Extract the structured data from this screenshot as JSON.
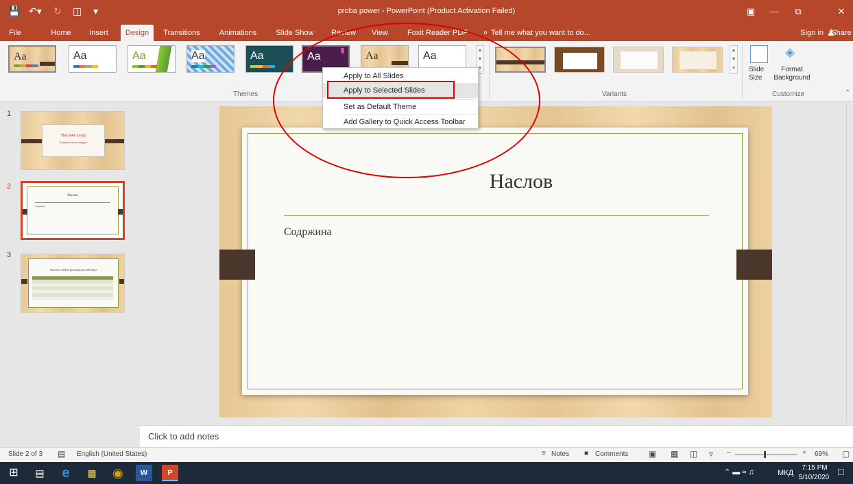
{
  "window": {
    "title": "proba power - PowerPoint (Product Activation Failed)",
    "quick_access": [
      "save-icon",
      "undo-icon",
      "redo-icon",
      "start-from-beginning-icon",
      "customize-icon"
    ]
  },
  "tabs": [
    "File",
    "Home",
    "Insert",
    "Design",
    "Transitions",
    "Animations",
    "Slide Show",
    "Review",
    "View",
    "Foxit Reader PDF"
  ],
  "tell_me": "Tell me what you want to do...",
  "account": {
    "sign_in": "Sign in",
    "share": "Share"
  },
  "ribbon": {
    "themes_label": "Themes",
    "variants_label": "Variants",
    "customize_label": "Customize",
    "theme_aa": "Aa",
    "slide_size": [
      "Slide",
      "Size"
    ],
    "format_background": [
      "Format",
      "Background"
    ]
  },
  "context_menu": {
    "items": [
      "Apply to All Slides",
      "Apply to Selected Slides",
      "Set as Default Theme",
      "Add Gallery to Quick Access Toolbar"
    ]
  },
  "thumbnails": [
    {
      "num": "1",
      "title": "Наслове слајд",
      "subtitle": "Поднаслов на слајдот"
    },
    {
      "num": "2",
      "title": "Наслов",
      "body": "Содржина"
    },
    {
      "num": "3",
      "title": "Наслов и табела (распоред на табелата)"
    }
  ],
  "slide": {
    "title": "Наслов",
    "body": "Содржина"
  },
  "notes_placeholder": "Click to add notes",
  "status": {
    "slide_info": "Slide 2 of 3",
    "language": "English (United States)",
    "notes": "Notes",
    "comments": "Comments",
    "zoom": "69%"
  },
  "taskbar": {
    "lang": "МКД",
    "time": "7:15 PM",
    "date": "5/10/2020"
  },
  "colors": {
    "accent": "#b7472a",
    "annotation": "#e00000"
  }
}
